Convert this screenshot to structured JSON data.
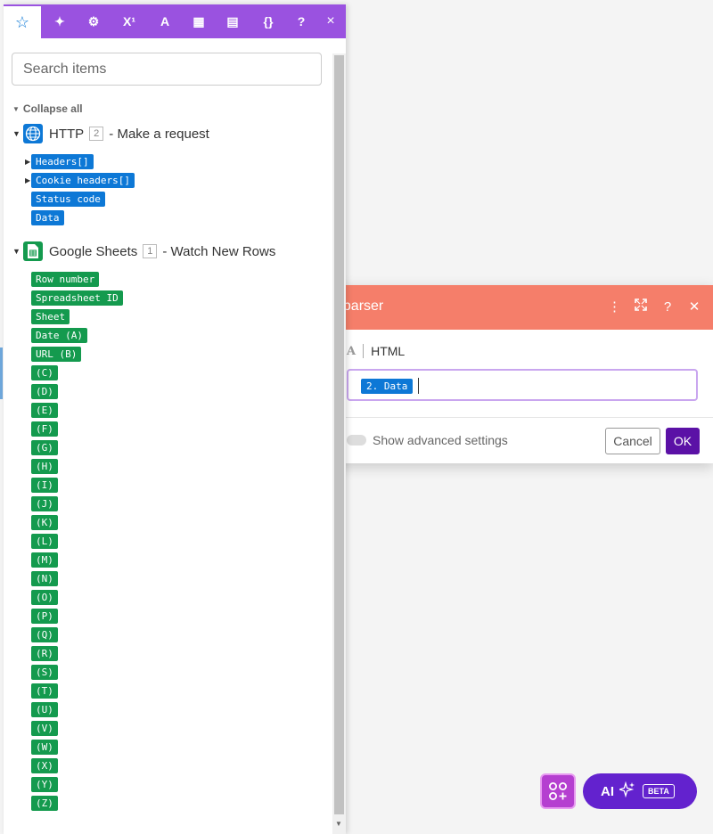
{
  "dialog": {
    "title": "t parser",
    "field_label": "HTML",
    "field_type_icon": "A",
    "field_pill": "2. Data",
    "advanced_label": "Show advanced settings",
    "cancel_label": "Cancel",
    "ok_label": "OK"
  },
  "ai_button": {
    "label": "AI",
    "badge": "BETA"
  },
  "panel": {
    "tabs": [
      "star-icon",
      "sparkle-icon",
      "gear-icon",
      "superscript-icon",
      "text-icon",
      "calendar-icon",
      "table-icon",
      "braces-icon"
    ],
    "tab_glyphs": [
      "☆",
      "✦",
      "⚙",
      "X¹",
      "A",
      "▦",
      "▤",
      "{}"
    ],
    "help_label": "?",
    "close_label": "×",
    "search_placeholder": "Search items",
    "collapse_all": "Collapse all",
    "modules": [
      {
        "name": "HTTP",
        "number": "2",
        "action": "- Make a request",
        "color": "#0d78d6",
        "items": [
          {
            "label": "Headers[]",
            "expandable": true
          },
          {
            "label": "Cookie headers[]",
            "expandable": true
          },
          {
            "label": "Status code",
            "expandable": false
          },
          {
            "label": "Data",
            "expandable": false
          }
        ]
      },
      {
        "name": "Google Sheets",
        "number": "1",
        "action": "- Watch New Rows",
        "color": "#149a4e",
        "items": [
          {
            "label": "Row number"
          },
          {
            "label": "Spreadsheet ID"
          },
          {
            "label": "Sheet"
          },
          {
            "label": "Date (A)"
          },
          {
            "label": "URL (B)"
          },
          {
            "label": "(C)"
          },
          {
            "label": "(D)"
          },
          {
            "label": "(E)"
          },
          {
            "label": "(F)"
          },
          {
            "label": "(G)"
          },
          {
            "label": "(H)"
          },
          {
            "label": "(I)"
          },
          {
            "label": "(J)"
          },
          {
            "label": "(K)"
          },
          {
            "label": "(L)"
          },
          {
            "label": "(M)"
          },
          {
            "label": "(N)"
          },
          {
            "label": "(O)"
          },
          {
            "label": "(P)"
          },
          {
            "label": "(Q)"
          },
          {
            "label": "(R)"
          },
          {
            "label": "(S)"
          },
          {
            "label": "(T)"
          },
          {
            "label": "(U)"
          },
          {
            "label": "(V)"
          },
          {
            "label": "(W)"
          },
          {
            "label": "(X)"
          },
          {
            "label": "(Y)"
          },
          {
            "label": "(Z)"
          }
        ]
      }
    ]
  }
}
